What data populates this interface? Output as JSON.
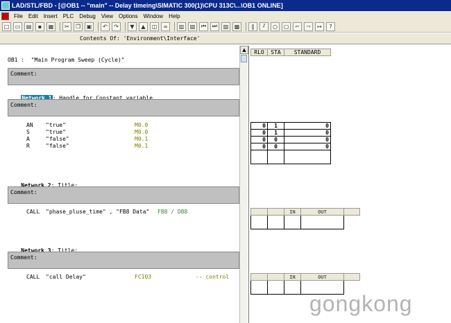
{
  "window": {
    "title": "LAD/STL/FBD  - [@OB1 -- \"main\" -- Delay timeing\\SIMATIC 300(1)\\CPU 313C\\...\\OB1  ONLINE]"
  },
  "menubar": {
    "items": [
      "File",
      "Edit",
      "Insert",
      "PLC",
      "Debug",
      "View",
      "Options",
      "Window",
      "Help"
    ]
  },
  "pathbar": {
    "text": "Contents Of: 'Environment\\Interface'"
  },
  "editor": {
    "block_header": "OB1 :  \"Main Program Sweep (Cycle)\"",
    "comment_label": "Comment:",
    "networks": [
      {
        "label": "Network 1",
        "title": ": Handle for Constant variable",
        "comment": "Comment:",
        "instructions": [
          {
            "op": "AN",
            "symbol": "\"true\"",
            "addr": "M0.0"
          },
          {
            "op": "S",
            "symbol": "\"true\"",
            "addr": "M0.0"
          },
          {
            "op": "A",
            "symbol": "\"false\"",
            "addr": "M0.1"
          },
          {
            "op": "R",
            "symbol": "\"false\"",
            "addr": "M0.1"
          }
        ]
      },
      {
        "label": "Network 2",
        "title": ": Title:",
        "comment": "Comment:",
        "call": {
          "op": "CALL",
          "args": "\"phase_pluse_time\" , \"FB8 Data\"",
          "addr": "FB8 / DB8"
        }
      },
      {
        "label": "Network 3",
        "title": ": Title:",
        "comment": "Comment:",
        "call": {
          "op": "CALL",
          "args": "\"call Delay\"",
          "addr": "FC103",
          "note": "-- control"
        }
      }
    ]
  },
  "status": {
    "headers": [
      "RLO",
      "STA",
      "STANDARD"
    ],
    "rows": [
      [
        "0",
        "1",
        "0"
      ],
      [
        "0",
        "1",
        "0"
      ],
      [
        "0",
        "0",
        "0"
      ],
      [
        "0",
        "0",
        "0"
      ]
    ],
    "io_headers": [
      "IN",
      "OUT"
    ]
  },
  "watermark": "gongkong"
}
